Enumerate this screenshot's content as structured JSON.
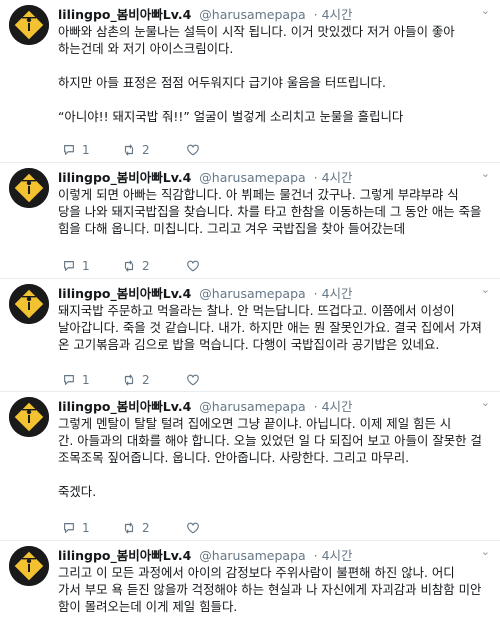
{
  "colors": {
    "text": "#14171a",
    "muted": "#657786",
    "divider": "#e6ecf0",
    "avatar_bg": "#1a1a1a",
    "avatar_sign": "#f2c230"
  },
  "icons": {
    "reply": "reply-icon",
    "retweet": "retweet-icon",
    "like": "like-icon",
    "more": "chevron-down-icon"
  },
  "tweets": [
    {
      "name": "lilingpo_봄비아빠Lv.4",
      "handle": "@harusamepapa",
      "time": "· 4시간",
      "text": "아빠와 삼촌의 눈물나는 설득이 시작 됩니다. 이거 맛있겠다 저거 아들이 좋아\n하는건데 와 저기 아이스크림이다.\n\n하지만 아들 표정은 점점 어두워지다 급기야 울음을 터뜨립니다.\n\n“아니야!! 돼지국밥 줘!!” 얼굴이 벌겋게 소리치고 눈물을 흘립니다",
      "replies": "1",
      "retweets": "2",
      "likes": ""
    },
    {
      "name": "lilingpo_봄비아빠Lv.4",
      "handle": "@harusamepapa",
      "time": "· 4시간",
      "text": "이렇게 되면 아빠는 직감합니다. 아 뷔페는 물건너 갔구나. 그렇게 부랴부랴 식\n당을 나와 돼지국밥집을 찾습니다. 차를 타고 한참을 이동하는데 그 동안 애는 죽을\n힘을 다해 웁니다. 미칩니다. 그리고 겨우 국밥집을 찾아 들어갔는데",
      "replies": "1",
      "retweets": "2",
      "likes": ""
    },
    {
      "name": "lilingpo_봄비아빠Lv.4",
      "handle": "@harusamepapa",
      "time": "· 4시간",
      "text": "돼지국밥 주문하고 먹을라는 찰나. 안 먹는답니다. 뜨겁다고. 이쯤에서 이성이\n날아갑니다. 죽을 것 같습니다. 내가. 하지만 애는 뭔 잘못인가요. 결국 집에서 가져\n온 고기볶음과 김으로 밥을 먹습니다. 다행이 국밥집이라 공기밥은 있네요.",
      "replies": "1",
      "retweets": "2",
      "likes": ""
    },
    {
      "name": "lilingpo_봄비아빠Lv.4",
      "handle": "@harusamepapa",
      "time": "· 4시간",
      "text": "그렇게 멘탈이 탈탈 털려 집에오면 그냥 끝이냐. 아닙니다. 이제 제일 힘든 시\n간. 아들과의 대화를 해야 합니다. 오늘 있었던 일 다 되집어 보고 아들이 잘못한 걸\n조목조목 짚어줍니다. 웁니다. 안아줍니다. 사랑한다. 그리고 마무리.\n\n죽겠다.",
      "replies": "1",
      "retweets": "2",
      "likes": ""
    },
    {
      "name": "lilingpo_봄비아빠Lv.4",
      "handle": "@harusamepapa",
      "time": "· 4시간",
      "text": "그리고 이 모든 과정에서 아이의 감정보다 주위사람이 불편해 하진 않나. 어디\n가서 부모 욕 듣진 않을까 걱정해야 하는 현실과 나 자신에게 자괴감과 비참함 미안\n함이 몰려오는데 이게 제일 힘들다.",
      "replies": "",
      "retweets": "",
      "likes": ""
    }
  ]
}
